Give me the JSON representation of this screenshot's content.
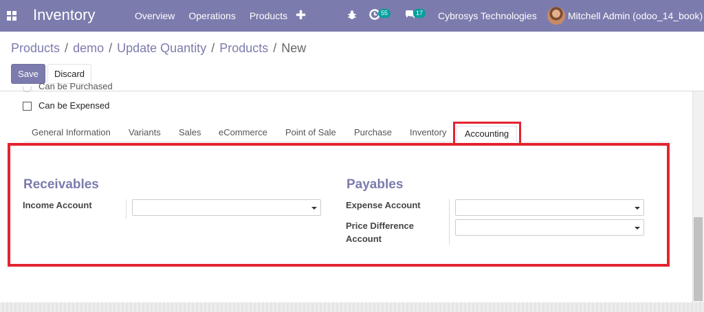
{
  "navbar": {
    "app_title": "Inventory",
    "menu": [
      "Overview",
      "Operations",
      "Products"
    ],
    "plus": "✚",
    "activity_count": "55",
    "chat_count": "17",
    "company": "Cybrosys Technologies",
    "user": "Mitchell Admin (odoo_14_book)"
  },
  "breadcrumb": [
    "Products",
    "demo",
    "Update Quantity",
    "Products",
    "New"
  ],
  "buttons": {
    "save": "Save",
    "discard": "Discard"
  },
  "form": {
    "cut_label": "Can be Purchased",
    "expensed_label": "Can be Expensed"
  },
  "tabs": [
    "General Information",
    "Variants",
    "Sales",
    "eCommerce",
    "Point of Sale",
    "Purchase",
    "Inventory",
    "Accounting"
  ],
  "accounting": {
    "receivables": {
      "title": "Receivables",
      "income_label": "Income Account",
      "income_value": ""
    },
    "payables": {
      "title": "Payables",
      "expense_label": "Expense Account",
      "expense_value": "",
      "price_diff_label_1": "Price Difference",
      "price_diff_label_2": "Account",
      "price_diff_value": ""
    }
  },
  "colors": {
    "brand": "#7c7bad",
    "highlight": "#e3232f",
    "badge": "#00a09d"
  }
}
